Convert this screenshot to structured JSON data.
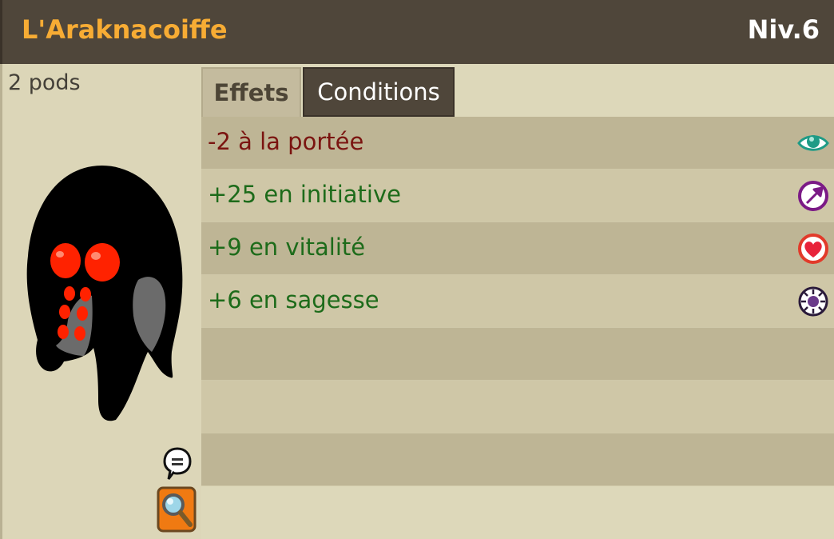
{
  "item": {
    "name": "L'Araknacoiffe",
    "level": "Niv.6",
    "weight": "2 pods"
  },
  "tabs": [
    {
      "label": "Effets",
      "active": true
    },
    {
      "label": "Conditions",
      "active": false
    }
  ],
  "effects": [
    {
      "text": "-2 à la portée",
      "color": "#7b1410",
      "icon": "range-eye-icon"
    },
    {
      "text": "+25 en initiative",
      "color": "#1d6b1a",
      "icon": "initiative-arrow-icon"
    },
    {
      "text": "+9 en vitalité",
      "color": "#1d6b1a",
      "icon": "vitality-heart-icon"
    },
    {
      "text": "+6 en sagesse",
      "color": "#1d6b1a",
      "icon": "wisdom-eye-icon"
    }
  ],
  "colors": {
    "header_bg": "#4f463a",
    "title": "#f7ac34",
    "bonus": "#1d6b1a",
    "malus": "#7b1410"
  }
}
